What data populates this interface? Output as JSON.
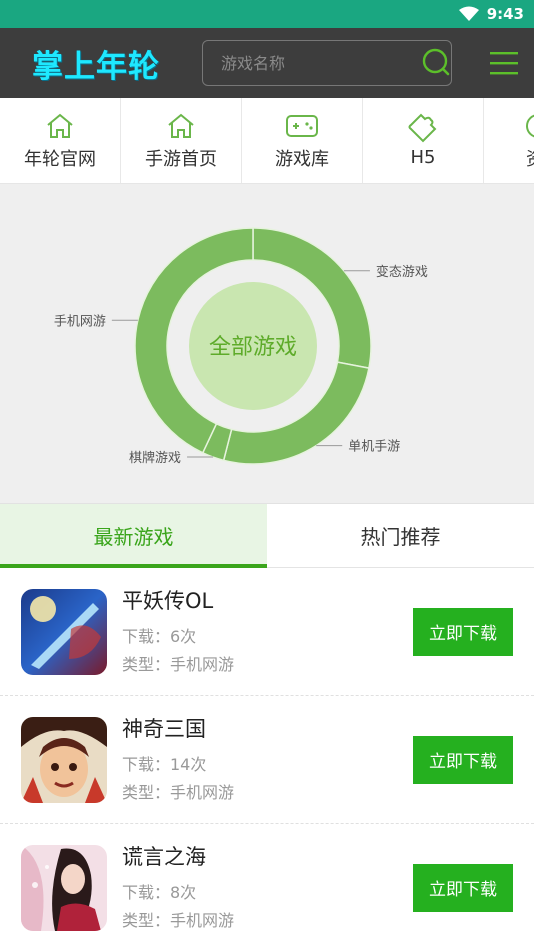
{
  "status_bar": {
    "time": "9:43"
  },
  "header": {
    "logo_text": "掌上年轮",
    "search_placeholder": "游戏名称"
  },
  "nav": {
    "items": [
      {
        "label": "年轮官网",
        "icon": "home-icon"
      },
      {
        "label": "手游首页",
        "icon": "home-icon"
      },
      {
        "label": "游戏库",
        "icon": "gamepad-icon"
      },
      {
        "label": "H5",
        "icon": "puzzle-icon"
      },
      {
        "label": "资",
        "icon": "more-icon"
      }
    ]
  },
  "chart_data": {
    "type": "pie",
    "center_label": "全部游戏",
    "categories": [
      "变态游戏",
      "单机手游",
      "棋牌游戏",
      "手机网游"
    ],
    "values": [
      28,
      26,
      3,
      43
    ],
    "colors": {
      "ring": "#7cbb5e",
      "center": "#c9e6b0",
      "center_text": "#5eab2a",
      "divider": "#e6f3dd"
    }
  },
  "tabs": [
    {
      "label": "最新游戏",
      "active": true
    },
    {
      "label": "热门推荐",
      "active": false
    }
  ],
  "games": [
    {
      "name": "平妖传OL",
      "downloads": "下载：6次",
      "type": "类型：手机网游",
      "button": "立即下载",
      "icon": "game-icon-pingyaozhuan"
    },
    {
      "name": "神奇三国",
      "downloads": "下载：14次",
      "type": "类型：手机网游",
      "button": "立即下载",
      "icon": "game-icon-shenqisanguo"
    },
    {
      "name": "谎言之海",
      "downloads": "下载：8次",
      "type": "类型：手机网游",
      "button": "立即下载",
      "icon": "game-icon-huangyanzhihai"
    }
  ],
  "colors": {
    "status_bar": "#1aa781",
    "header": "#3d3d3d",
    "accent": "#3aa51b",
    "button": "#25b01f"
  }
}
